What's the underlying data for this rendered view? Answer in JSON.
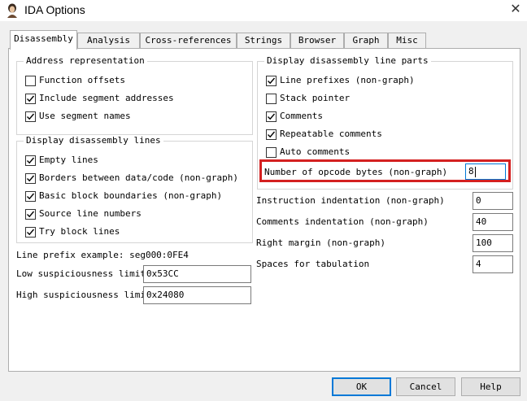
{
  "window": {
    "title": "IDA Options",
    "close_glyph": "✕"
  },
  "tabs": [
    {
      "label": "Disassembly",
      "active": true
    },
    {
      "label": "Analysis"
    },
    {
      "label": "Cross-references"
    },
    {
      "label": "Strings"
    },
    {
      "label": "Browser"
    },
    {
      "label": "Graph"
    },
    {
      "label": "Misc"
    }
  ],
  "address_representation": {
    "title": "Address representation",
    "options": [
      {
        "label": "Function offsets",
        "checked": false
      },
      {
        "label": "Include segment addresses",
        "checked": true
      },
      {
        "label": "Use segment names",
        "checked": true
      }
    ]
  },
  "disassembly_lines": {
    "title": "Display disassembly lines",
    "options": [
      {
        "label": "Empty lines",
        "checked": true
      },
      {
        "label": "Borders between data/code (non-graph)",
        "checked": true
      },
      {
        "label": "Basic block boundaries (non-graph)",
        "checked": true
      },
      {
        "label": "Source line numbers",
        "checked": true
      },
      {
        "label": "Try block lines",
        "checked": true
      }
    ]
  },
  "line_parts": {
    "title": "Display disassembly line parts",
    "options": [
      {
        "label": "Line prefixes (non-graph)",
        "checked": true
      },
      {
        "label": "Stack pointer",
        "checked": false
      },
      {
        "label": "Comments",
        "checked": true
      },
      {
        "label": "Repeatable comments",
        "checked": true
      },
      {
        "label": "Auto comments",
        "checked": false
      }
    ]
  },
  "line_prefix_example": "Line prefix example: seg000:0FE4",
  "suspiciousness": {
    "low_label": "Low suspiciousness limit",
    "low_value": "0x53CC",
    "high_label": "High suspiciousness limit",
    "high_value": "0x24080"
  },
  "numeric_fields": {
    "opcode_bytes": {
      "label": "Number of opcode bytes (non-graph)",
      "value": "8"
    },
    "instruction_indent": {
      "label": "Instruction indentation (non-graph)",
      "value": "0"
    },
    "comments_indent": {
      "label": "Comments indentation (non-graph)",
      "value": "40"
    },
    "right_margin": {
      "label": "Right margin (non-graph)",
      "value": "100"
    },
    "tab_spaces": {
      "label": "Spaces for tabulation",
      "value": "4"
    }
  },
  "buttons": {
    "ok": "OK",
    "cancel": "Cancel",
    "help": "Help"
  },
  "colors": {
    "highlight": "#d42020",
    "focus": "#0078d7"
  }
}
